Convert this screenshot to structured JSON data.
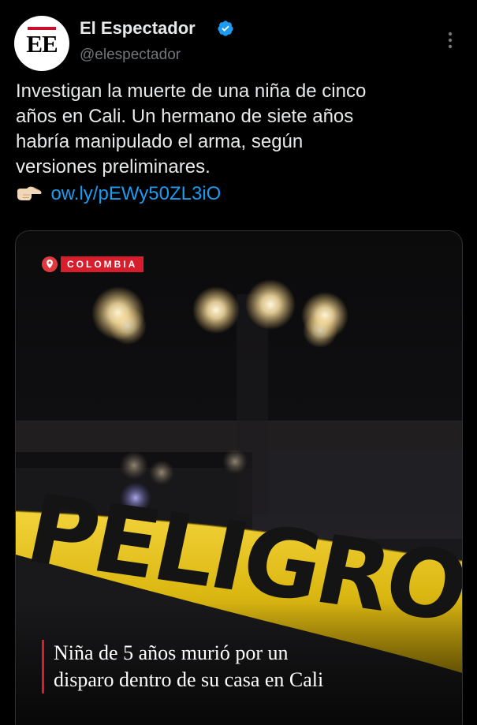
{
  "account": {
    "avatar_text": "EE",
    "display_name": "El Espectador",
    "handle": "@elespectador",
    "verified": true,
    "avatar_icon": "el-espectador-logo"
  },
  "tweet": {
    "text_lines": [
      "Investigan la muerte de una niña de cinco",
      "años en Cali. Un hermano de siete años",
      "habría manipulado el arma, según",
      "versiones preliminares."
    ],
    "link_emoji": "pointing-right-hand-emoji",
    "link": "ow.ly/pEWy50ZL3iO"
  },
  "card": {
    "section_label": "COLOMBIA",
    "tape_text": "PELIGRO",
    "headline_lines": [
      "Niña de 5 años murió por un",
      "disparo dentro de su casa en Cali"
    ]
  },
  "colors": {
    "background": "#000000",
    "text": "#e7e9ea",
    "secondary": "#71767b",
    "link": "#1d9bf0",
    "verified": "#1d9bf0",
    "accent_red": "#d81e2c",
    "tape_yellow": "#e8c21a"
  }
}
